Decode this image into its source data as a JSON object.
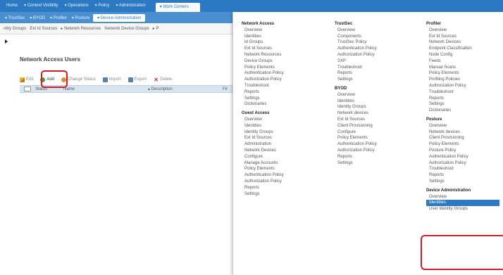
{
  "topnav": {
    "items": [
      "Home",
      "▾ Context Visibility",
      "▾ Operations",
      "▾ Policy",
      "▾ Administration"
    ],
    "active": "▾ Work Centers"
  },
  "subnav": {
    "items": [
      "▾ TrustSec",
      "▾ BYOD",
      "▾ Profiler",
      "▾ Posture"
    ],
    "selected": "▾ Device Administration"
  },
  "thirdnav": {
    "items": [
      "ntity Groups",
      "Ext Id Sources",
      "▸ Network Resources",
      "Network Device Groups",
      "▸ P"
    ]
  },
  "page": {
    "title": "Network Access Users"
  },
  "toolbar": {
    "edit": "Edit",
    "add": "Add",
    "change_status": "Change Status",
    "import": "Import",
    "export": "Export",
    "delete": "Delete"
  },
  "table": {
    "headers": [
      "Status",
      "Name",
      "▴ Description",
      "Fir"
    ]
  },
  "menu": {
    "network_access": {
      "title": "Network Access",
      "items": [
        "Overview",
        "Identities",
        "Id Groups",
        "Ext Id Sources",
        "Network Resources",
        "Device Groups",
        "Policy Elements",
        "Authentication Policy",
        "Authorization Policy",
        "Troubleshoot",
        "Reports",
        "Settings",
        "Dictionaries"
      ]
    },
    "guest_access": {
      "title": "Guest Access",
      "items": [
        "Overview",
        "Identities",
        "Identity Groups",
        "Ext Id Sources",
        "Administration",
        "Network Devices",
        "Configure",
        "Manage Accounts",
        "Policy Elements",
        "Authentication Policy",
        "Authorization Policy",
        "Reports",
        "Settings"
      ]
    },
    "trustsec": {
      "title": "TrustSec",
      "items": [
        "Overview",
        "Components",
        "TrustSec Policy",
        "Authentication Policy",
        "Authorization Policy",
        "SXP",
        "Troubleshoot",
        "Reports",
        "Settings"
      ]
    },
    "byod": {
      "title": "BYOD",
      "items": [
        "Overview",
        "Identities",
        "Identity Groups",
        "Network devices",
        "Ext Id Sources",
        "Client Provisioning",
        "Configure",
        "Policy Elements",
        "Authentication Policy",
        "Authorization Policy",
        "Reports",
        "Settings"
      ]
    },
    "profiler": {
      "title": "Profiler",
      "items": [
        "Overview",
        "Ext Id Sources",
        "Network Devices",
        "Endpoint Classification",
        "Node Config",
        "Feeds",
        "Manual Scans",
        "Policy Elements",
        "Profiling Policies",
        "Authorization Policy",
        "Troubleshoot",
        "Reports",
        "Settings",
        "Dictionaries"
      ]
    },
    "posture": {
      "title": "Posture",
      "items": [
        "Overview",
        "Network devices",
        "Client Provisioning",
        "Policy Elements",
        "Posture Policy",
        "Authentication Policy",
        "Authorization Policy",
        "Troubleshoot",
        "Reports",
        "Settings"
      ]
    },
    "device_admin": {
      "title": "Device Administration",
      "items": [
        "Overview",
        "Identities",
        "User Identity Groups"
      ]
    }
  },
  "colors": {
    "nav_blue": "#2b79c2",
    "highlight_red": "#d51a2a"
  }
}
